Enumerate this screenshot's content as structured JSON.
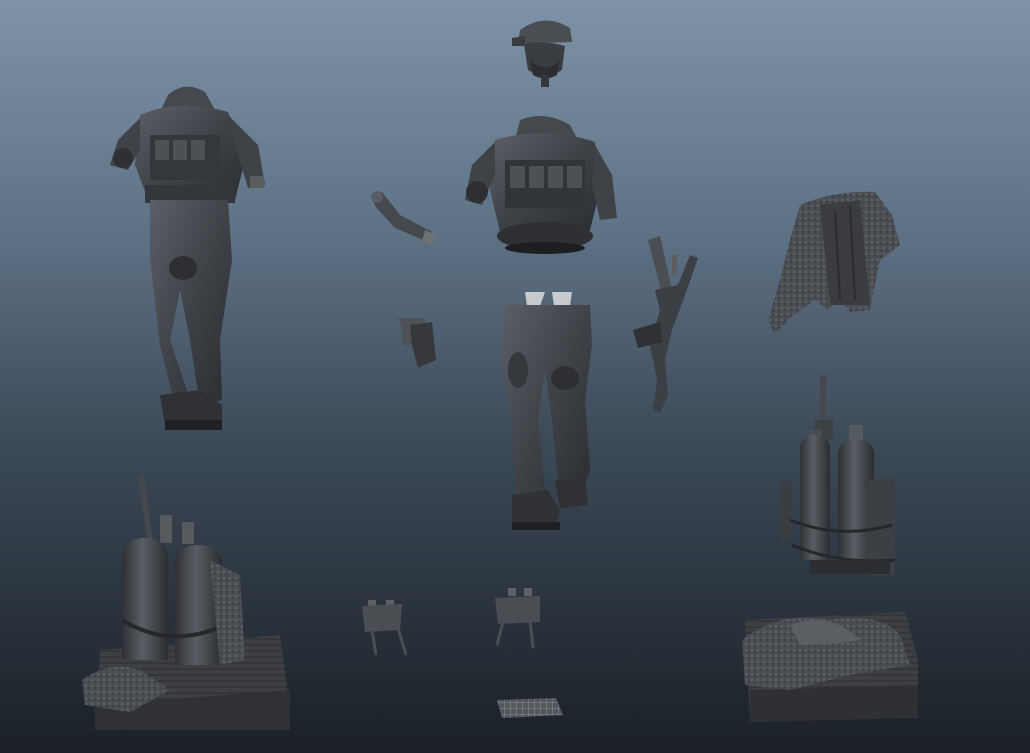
{
  "viewport": {
    "background_top": "#7f93a8",
    "background_bottom": "#1a2026"
  },
  "palette": {
    "mesh_dark": "#2f3237",
    "mesh_mid": "#45484d",
    "mesh_light": "#62666b",
    "mesh_highlight": "#8a8e92",
    "wood_crate": "#3c3e42"
  },
  "scene_parts": [
    {
      "id": "assembled-soldier",
      "icon": "soldier-full-body-icon"
    },
    {
      "id": "head-with-cap",
      "icon": "head-icon"
    },
    {
      "id": "torso-vest",
      "icon": "torso-icon"
    },
    {
      "id": "arm-piece",
      "icon": "arm-icon"
    },
    {
      "id": "pistol-holster",
      "icon": "pistol-icon"
    },
    {
      "id": "legs-pants",
      "icon": "legs-icon"
    },
    {
      "id": "rifle",
      "icon": "rifle-icon"
    },
    {
      "id": "cloak-cloth",
      "icon": "cloak-icon"
    },
    {
      "id": "air-tanks-upright",
      "icon": "air-tanks-icon"
    },
    {
      "id": "tanks-on-crate",
      "icon": "crate-with-tanks-icon"
    },
    {
      "id": "claymore-mine-left",
      "icon": "claymore-mine-icon"
    },
    {
      "id": "claymore-mine-right",
      "icon": "claymore-mine-icon"
    },
    {
      "id": "mesh-grid-plate",
      "icon": "grid-plate-icon"
    },
    {
      "id": "crate-with-cloth",
      "icon": "crate-cloth-icon"
    }
  ]
}
